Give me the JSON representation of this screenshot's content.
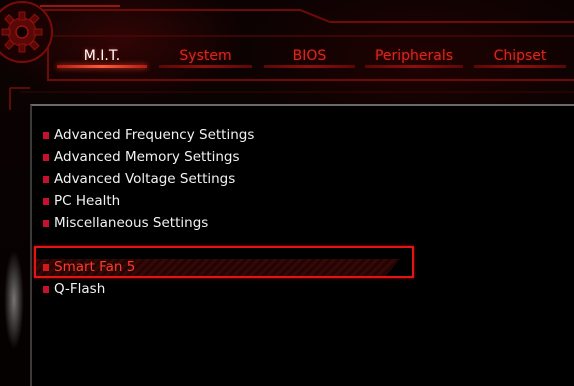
{
  "tabs": [
    {
      "label": "M.I.T.",
      "active": true
    },
    {
      "label": "System",
      "active": false
    },
    {
      "label": "BIOS",
      "active": false
    },
    {
      "label": "Peripherals",
      "active": false
    },
    {
      "label": "Chipset",
      "active": false
    }
  ],
  "menu": {
    "items": [
      {
        "label": "Advanced Frequency Settings"
      },
      {
        "label": "Advanced Memory Settings"
      },
      {
        "label": "Advanced Voltage Settings"
      },
      {
        "label": "PC Health"
      },
      {
        "label": "Miscellaneous Settings"
      },
      {
        "label": "Smart Fan 5",
        "selected": true
      },
      {
        "label": "Q-Flash"
      }
    ]
  },
  "icons": {
    "logo": "gear-icon"
  },
  "colors": {
    "accent": "#d8281e",
    "highlight": "#e41414",
    "bullet": "#c8102e",
    "text": "#f2f2f2"
  }
}
